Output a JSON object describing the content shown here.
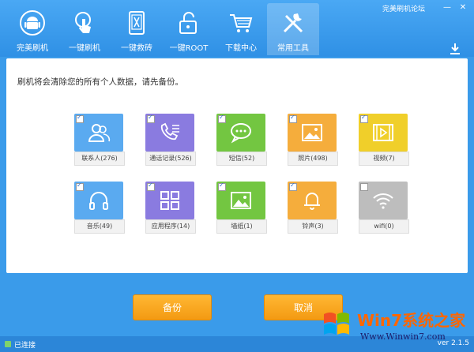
{
  "window": {
    "forum_link": "完美刷机论坛",
    "minimize_label": "—",
    "close_label": "✕"
  },
  "nav": [
    {
      "label": "完美刷机",
      "icon": "android-icon",
      "active": false
    },
    {
      "label": "一键刷机",
      "icon": "touch-icon",
      "active": false
    },
    {
      "label": "一键救砖",
      "icon": "phone-repair-icon",
      "active": false
    },
    {
      "label": "一键ROOT",
      "icon": "unlock-icon",
      "active": false
    },
    {
      "label": "下载中心",
      "icon": "cart-icon",
      "active": false
    },
    {
      "label": "常用工具",
      "icon": "tools-icon",
      "active": true
    }
  ],
  "notice": "刷机将会清除您的所有个人数据，请先备份。",
  "tiles": [
    {
      "label": "联系人(276)",
      "icon": "contacts-icon",
      "color": "#5aaaf0",
      "checked": true
    },
    {
      "label": "通话记录(526)",
      "icon": "call-log-icon",
      "color": "#8a7be0",
      "checked": true
    },
    {
      "label": "短信(52)",
      "icon": "sms-icon",
      "color": "#73c641",
      "checked": true
    },
    {
      "label": "照片(498)",
      "icon": "photo-icon",
      "color": "#f5ad3c",
      "checked": true
    },
    {
      "label": "视频(7)",
      "icon": "video-icon",
      "color": "#f0cf2a",
      "checked": true
    },
    {
      "label": "音乐(49)",
      "icon": "headphones-icon",
      "color": "#5aaaf0",
      "checked": true
    },
    {
      "label": "应用程序(14)",
      "icon": "apps-icon",
      "color": "#8a7be0",
      "checked": true
    },
    {
      "label": "墙纸(1)",
      "icon": "wallpaper-icon",
      "color": "#73c641",
      "checked": true
    },
    {
      "label": "铃声(3)",
      "icon": "bell-icon",
      "color": "#f5ad3c",
      "checked": true
    },
    {
      "label": "wifi(0)",
      "icon": "wifi-icon",
      "color": "#bdbdbd",
      "checked": false
    }
  ],
  "buttons": {
    "backup": "备份",
    "cancel": "取消"
  },
  "status": {
    "connection": "已连接",
    "version": "ver 2.1.5"
  },
  "watermark": {
    "title": "Win7系统之家",
    "url": "Www.Winwin7.com"
  }
}
